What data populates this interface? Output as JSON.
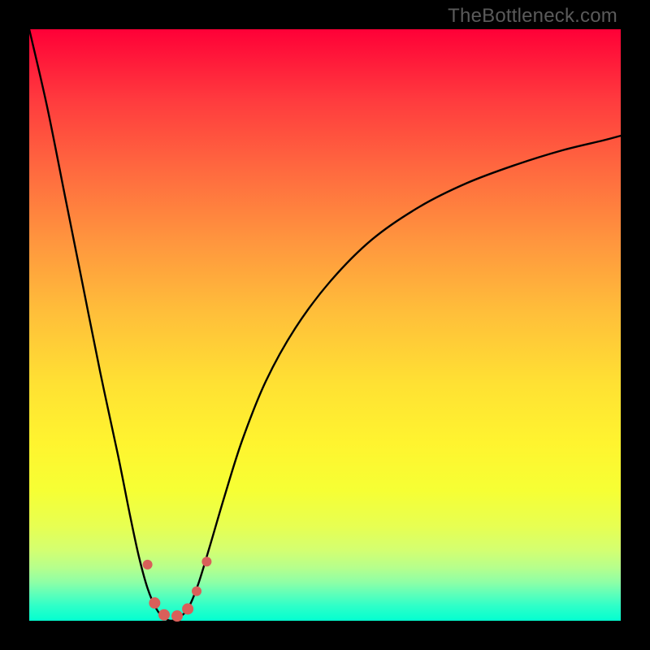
{
  "watermark": "TheBottleneck.com",
  "chart_data": {
    "type": "line",
    "title": "",
    "xlabel": "",
    "ylabel": "",
    "xlim": [
      0,
      1
    ],
    "ylim": [
      0,
      1
    ],
    "series": [
      {
        "name": "bottleneck-curve",
        "color": "#000000",
        "x": [
          0.0,
          0.03,
          0.06,
          0.09,
          0.12,
          0.15,
          0.17,
          0.185,
          0.2,
          0.215,
          0.228,
          0.24,
          0.252,
          0.268,
          0.285,
          0.305,
          0.33,
          0.36,
          0.4,
          0.45,
          0.51,
          0.58,
          0.66,
          0.74,
          0.82,
          0.9,
          0.97,
          1.0
        ],
        "y": [
          1.0,
          0.87,
          0.72,
          0.57,
          0.42,
          0.28,
          0.18,
          0.11,
          0.055,
          0.02,
          0.005,
          0.0,
          0.005,
          0.02,
          0.06,
          0.125,
          0.21,
          0.305,
          0.405,
          0.495,
          0.575,
          0.645,
          0.7,
          0.74,
          0.77,
          0.795,
          0.812,
          0.82
        ]
      }
    ],
    "markers": {
      "name": "dip-markers",
      "color": "#d95f5a",
      "points": [
        {
          "x": 0.2,
          "y": 0.095,
          "r": 6
        },
        {
          "x": 0.212,
          "y": 0.03,
          "r": 7
        },
        {
          "x": 0.228,
          "y": 0.01,
          "r": 7
        },
        {
          "x": 0.25,
          "y": 0.008,
          "r": 7
        },
        {
          "x": 0.268,
          "y": 0.02,
          "r": 7
        },
        {
          "x": 0.283,
          "y": 0.05,
          "r": 6
        },
        {
          "x": 0.3,
          "y": 0.1,
          "r": 6
        }
      ]
    }
  }
}
